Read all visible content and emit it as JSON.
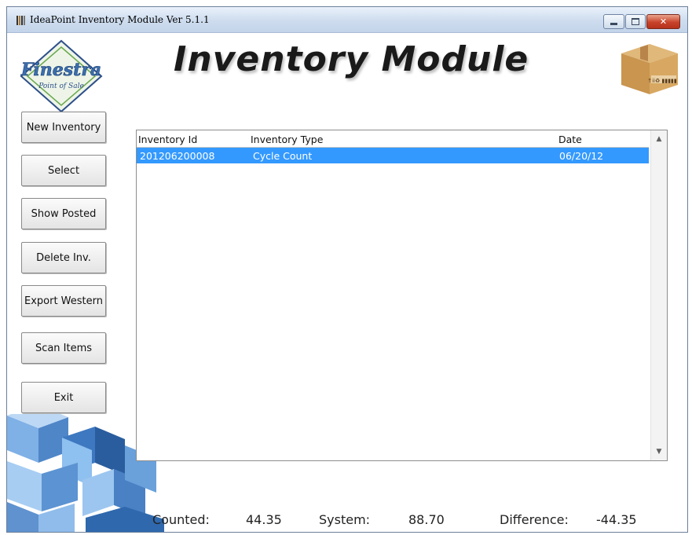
{
  "window": {
    "title": "IdeaPoint Inventory Module Ver 5.1.1"
  },
  "header": {
    "title": "Inventory Module",
    "logo_text_main": "Finestra",
    "logo_text_sub": "Point of Sale",
    "box_text": "↑ii♻ ▮▮▮▮▮"
  },
  "sidebar": {
    "buttons": [
      {
        "label": "New Inventory"
      },
      {
        "label": "Select"
      },
      {
        "label": "Show Posted"
      },
      {
        "label": "Delete Inv."
      },
      {
        "label": "Export Western"
      },
      {
        "label": "Scan Items"
      },
      {
        "label": "Exit"
      }
    ]
  },
  "grid": {
    "columns": [
      "Inventory Id",
      "Inventory Type",
      "Date"
    ],
    "rows": [
      {
        "id": "201206200008",
        "type": "Cycle Count",
        "date": "06/20/12",
        "selected": true
      }
    ]
  },
  "totals": {
    "counted_label": "Counted:",
    "counted_value": "44.35",
    "system_label": "System:",
    "system_value": "88.70",
    "difference_label": "Difference:",
    "difference_value": "-44.35"
  },
  "colors": {
    "selection": "#3399ff",
    "titlebar": "#cddcee"
  }
}
